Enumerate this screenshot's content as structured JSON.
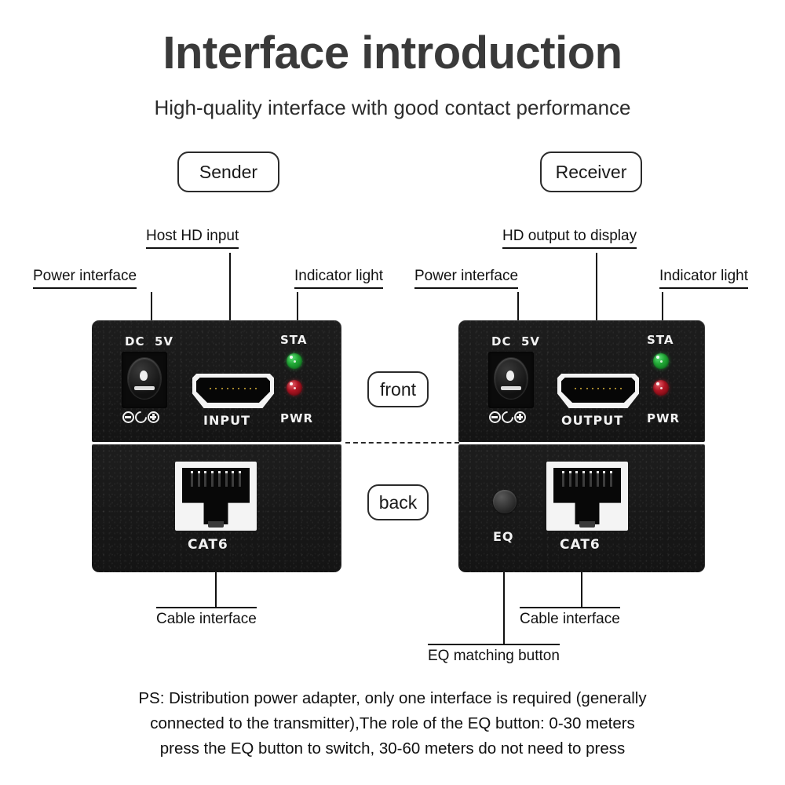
{
  "header": {
    "title": "Interface introduction",
    "subtitle": "High-quality interface with good contact performance"
  },
  "badges": {
    "sender": "Sender",
    "receiver": "Receiver",
    "front": "front",
    "back": "back"
  },
  "sender": {
    "top_label": "Host HD    input",
    "callouts": {
      "power": "Power interface",
      "indicator": "Indicator light",
      "cable": "Cable interface"
    },
    "silk": {
      "dc": "DC",
      "volt": "5V",
      "port": "INPUT",
      "sta": "STA",
      "pwr": "PWR",
      "cat6": "CAT6"
    },
    "leds": {
      "sta_color": "#21a835",
      "pwr_color": "#b01422"
    }
  },
  "receiver": {
    "top_label": "HD    output to display",
    "callouts": {
      "power": "Power interface",
      "indicator": "Indicator light",
      "cable": "Cable interface",
      "eq": "EQ matching button"
    },
    "silk": {
      "dc": "DC",
      "volt": "5V",
      "port": "OUTPUT",
      "sta": "STA",
      "pwr": "PWR",
      "cat6": "CAT6",
      "eq": "EQ"
    },
    "leds": {
      "sta_color": "#21a835",
      "pwr_color": "#b01422"
    }
  },
  "footnote": {
    "line1": "PS: Distribution power adapter, only one interface is required (generally",
    "line2": "connected to the transmitter),The role of the EQ button: 0-30 meters",
    "line3": "press the EQ button to switch, 30-60 meters do not need to press"
  }
}
